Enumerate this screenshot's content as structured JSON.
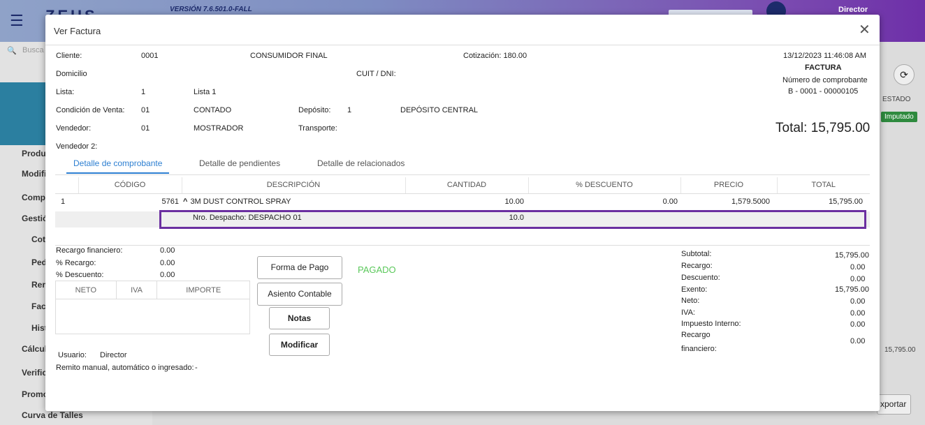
{
  "background": {
    "version": "VERSIÓN 7.6.501.0-FALL",
    "logo": "ZEUS",
    "user": "Director",
    "sidebar": [
      "Productos",
      "Modificar",
      "Compras",
      "Gestión",
      "Cotizaciones",
      "Pedidos",
      "Remitos",
      "Facturas",
      "Historial",
      "Cálculos",
      "Verificar",
      "Promociones",
      "Curva de Talles"
    ],
    "estado_header": "ESTADO",
    "estado_badge": "Imputado",
    "row_total": "15,795.00",
    "export_label": "xportar",
    "search_placeholder": "Busca",
    "refresh_icon": "refresh-icon"
  },
  "modal": {
    "title": "Ver Factura",
    "close": "✕",
    "header": {
      "cliente_label": "Cliente:",
      "cliente_code": "0001",
      "cliente_name": "CONSUMIDOR FINAL",
      "cotizacion": "Cotización: 180.00",
      "domicilio_label": "Domicilio",
      "cuit_label": "CUIT / DNI:",
      "lista_label": "Lista:",
      "lista_code": "1",
      "lista_name": "Lista 1",
      "condicion_label": "Condición de Venta:",
      "condicion_code": "01",
      "condicion_name": "CONTADO",
      "deposito_label": "Depósito:",
      "deposito_code": "1",
      "deposito_name": "DEPÓSITO CENTRAL",
      "vendedor_label": "Vendedor:",
      "vendedor_code": "01",
      "vendedor_name": "MOSTRADOR",
      "transporte_label": "Transporte:",
      "vendedor2_label": "Vendedor 2:",
      "datetime": "13/12/2023 11:46:08 AM",
      "doc_type": "FACTURA",
      "comprobante_label": "Número de comprobante",
      "comprobante_num": "B - 0001 - 00000105",
      "total": "Total: 15,795.00"
    },
    "tabs": [
      "Detalle de comprobante",
      "Detalle de pendientes",
      "Detalle de relacionados"
    ],
    "columns": [
      "CÓDIGO",
      "DESCRIPCIÓN",
      "CANTIDAD",
      "% DESCUENTO",
      "PRECIO",
      "TOTAL"
    ],
    "row": {
      "index": "1",
      "codigo": "5761",
      "toggle": "^",
      "descripcion": "3M DUST CONTROL SPRAY",
      "cantidad": "10.00",
      "descuento": "0.00",
      "precio": "1,579.5000",
      "total": "15,795.00"
    },
    "subrow": {
      "descripcion": "Nro. Despacho: DESPACHO 01",
      "cantidad": "10.0"
    },
    "footer_left": {
      "recargo_fin_label": "Recargo financiero:",
      "recargo_fin": "0.00",
      "pct_recargo_label": "% Recargo:",
      "pct_recargo": "0.00",
      "pct_descuento_label": "% Descuento:",
      "pct_descuento": "0.00",
      "tax_columns": [
        "NETO",
        "IVA",
        "IMPORTE"
      ],
      "usuario_label": "Usuario:",
      "usuario": "Director",
      "remito_label": "Remito manual, automático o ingresado:",
      "remito": "-"
    },
    "buttons": {
      "forma_pago": "Forma de Pago",
      "asiento": "Asiento Contable",
      "notas": "Notas",
      "modificar": "Modificar"
    },
    "status": "PAGADO",
    "status_color": "#5ac85a",
    "totals": [
      {
        "label": "Subtotal:",
        "value": "15,795.00"
      },
      {
        "label": "Recargo:",
        "value": "0.00"
      },
      {
        "label": "Descuento:",
        "value": "0.00"
      },
      {
        "label": "Exento:",
        "value": "15,795.00"
      },
      {
        "label": "Neto:",
        "value": "0.00"
      },
      {
        "label": "IVA:",
        "value": "0.00"
      },
      {
        "label": "Impuesto Interno:",
        "value": "0.00"
      }
    ],
    "recargo_fin_total_label_1": "Recargo",
    "recargo_fin_total_label_2": "financiero:",
    "recargo_fin_total": "0.00",
    "accent_color": "#2d7fd1",
    "highlight_color": "#6b2fa0"
  }
}
